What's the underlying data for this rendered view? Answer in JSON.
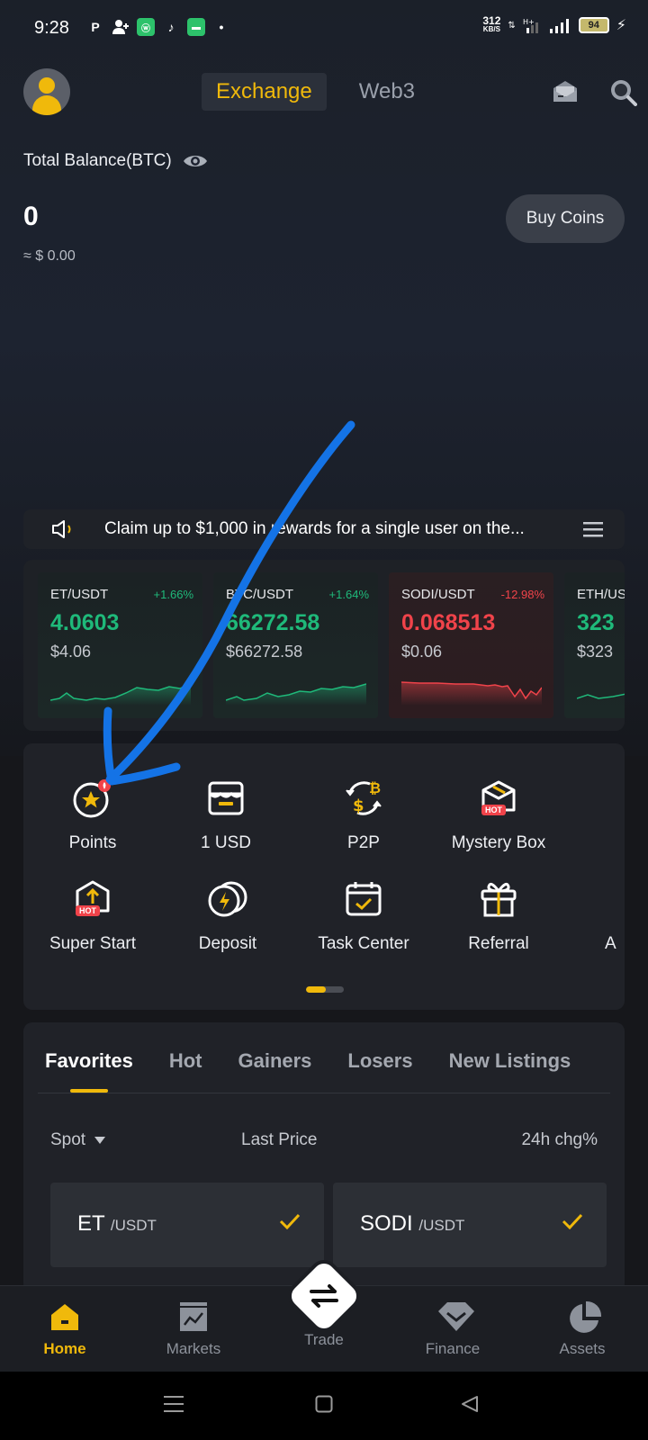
{
  "status_bar": {
    "time": "9:28",
    "net_speed": "312",
    "net_unit": "KB/S",
    "battery": "94"
  },
  "header": {
    "tabs": [
      {
        "label": "Exchange",
        "active": true
      },
      {
        "label": "Web3",
        "active": false
      }
    ]
  },
  "balance": {
    "label": "Total Balance(BTC)",
    "value": "0",
    "fiat": "≈ $ 0.00",
    "buy_button": "Buy Coins"
  },
  "announcement": {
    "text": "Claim up to $1,000 in rewards for a single user on the..."
  },
  "tickers": [
    {
      "pair": "ET/USDT",
      "change": "+1.66%",
      "price": "4.0603",
      "fiat": "$4.06",
      "trend": "up"
    },
    {
      "pair": "BTC/USDT",
      "change": "+1.64%",
      "price": "66272.58",
      "fiat": "$66272.58",
      "trend": "up"
    },
    {
      "pair": "SODI/USDT",
      "change": "-12.98%",
      "price": "0.068513",
      "fiat": "$0.06",
      "trend": "down"
    },
    {
      "pair": "ETH/USDT",
      "change": "",
      "price": "323",
      "fiat": "$323",
      "trend": "up"
    }
  ],
  "shortcuts": [
    {
      "label": "Points",
      "icon": "star-coin-icon"
    },
    {
      "label": "1 USD",
      "icon": "store-icon"
    },
    {
      "label": "P2P",
      "icon": "p2p-bitcoin-icon"
    },
    {
      "label": "Mystery Box",
      "icon": "mystery-box-icon",
      "badge": "HOT"
    },
    {
      "label": "Super Start",
      "icon": "super-start-icon",
      "badge": "HOT"
    },
    {
      "label": "Deposit",
      "icon": "deposit-coins-icon"
    },
    {
      "label": "Task Center",
      "icon": "calendar-check-icon"
    },
    {
      "label": "Referral",
      "icon": "gift-icon"
    },
    {
      "label": "A",
      "icon": "partial-item"
    }
  ],
  "markets": {
    "tabs": [
      "Favorites",
      "Hot",
      "Gainers",
      "Losers",
      "New Listings"
    ],
    "active_tab": "Favorites",
    "spot_label": "Spot",
    "last_price_label": "Last Price",
    "change_label": "24h chg%",
    "favorites": [
      {
        "base": "ET",
        "quote": "/USDT"
      },
      {
        "base": "SODI",
        "quote": "/USDT"
      }
    ]
  },
  "bottom_nav": [
    {
      "label": "Home",
      "active": true
    },
    {
      "label": "Markets",
      "active": false
    },
    {
      "label": "Trade",
      "active": false
    },
    {
      "label": "Finance",
      "active": false
    },
    {
      "label": "Assets",
      "active": false
    }
  ],
  "colors": {
    "accent": "#f0b90b",
    "up": "#1fb97a",
    "down": "#f0434a",
    "annotation_arrow": "#1473e6"
  }
}
